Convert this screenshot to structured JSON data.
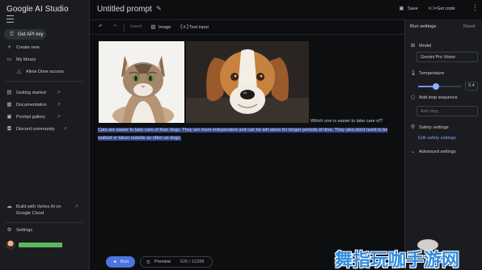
{
  "app": {
    "brand": "Google AI Studio"
  },
  "sidebar": {
    "get_api_key": "Get API key",
    "items": [
      {
        "label": "Create new",
        "icon": "plus-icon"
      },
      {
        "label": "My library",
        "icon": "folder-icon"
      }
    ],
    "sub_item": "Allow Drive access",
    "links": [
      {
        "label": "Getting started",
        "icon": "book-icon"
      },
      {
        "label": "Documentation",
        "icon": "doc-icon"
      },
      {
        "label": "Prompt gallery",
        "icon": "gallery-icon"
      },
      {
        "label": "Discord community",
        "icon": "chat-icon"
      }
    ],
    "vertex": "Build with Vertex AI on Google Cloud",
    "settings": "Settings"
  },
  "header": {
    "title": "Untitled prompt",
    "save": "Save",
    "get_code": "Get code"
  },
  "toolbar": {
    "insert": "Insert:",
    "image": "Image",
    "test_input": "Test input"
  },
  "editor": {
    "question": "Which one is easier to take care of?",
    "answer": "Cats are easier to take care of than dogs. They are more independent and can be left alone for longer periods of time. They also don't need to be walked or taken outside as often as dogs."
  },
  "run_bar": {
    "run": "Run",
    "preview": "Preview",
    "token_count": "526 / 12288"
  },
  "settings": {
    "title": "Run settings",
    "reset": "Reset",
    "model_label": "Model",
    "model_value": "Gemini Pro Vision",
    "temperature_label": "Temperature",
    "temperature_value": "0.4",
    "temperature_fraction": 0.4,
    "stop_label": "Add stop sequence",
    "stop_placeholder": "Add stop...",
    "safety_label": "Safety settings",
    "safety_link": "Edit safety settings",
    "advanced_label": "Advanced settings"
  },
  "watermark": {
    "text": "舞指玩咖手游网"
  },
  "colors": {
    "accent": "#4d74e0",
    "highlight": "#3a4a8c",
    "account_bar": "#5cb85c",
    "link": "#7aa2f7"
  }
}
